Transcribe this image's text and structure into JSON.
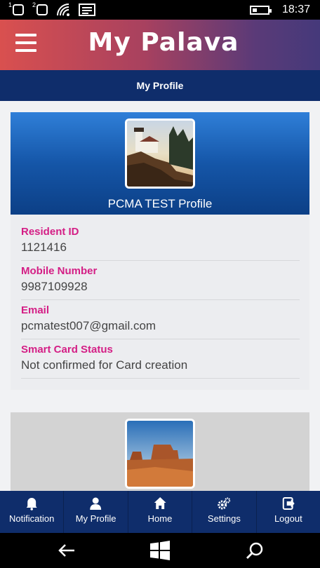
{
  "status_bar": {
    "sim1": "1",
    "sim2": "2",
    "time": "18:37"
  },
  "app_bar": {
    "title": "My Palava"
  },
  "sub_header": {
    "title": "My Profile"
  },
  "profile": {
    "name": "PCMA TEST Profile",
    "fields": [
      {
        "label": "Resident ID",
        "value": "1121416"
      },
      {
        "label": "Mobile Number",
        "value": "9987109928"
      },
      {
        "label": "Email",
        "value": "pcmatest007@gmail.com"
      },
      {
        "label": "Smart Card Status",
        "value": "Not confirmed for Card creation"
      }
    ]
  },
  "bottom_nav": {
    "items": [
      {
        "label": "Notification",
        "icon": "bell-icon"
      },
      {
        "label": "My Profile",
        "icon": "person-icon"
      },
      {
        "label": "Home",
        "icon": "home-icon"
      },
      {
        "label": "Settings",
        "icon": "gears-icon"
      },
      {
        "label": "Logout",
        "icon": "logout-icon"
      }
    ]
  },
  "colors": {
    "label_pink": "#d41e85",
    "nav_navy": "#0f2d6b",
    "header_blue": "#1556a8"
  }
}
